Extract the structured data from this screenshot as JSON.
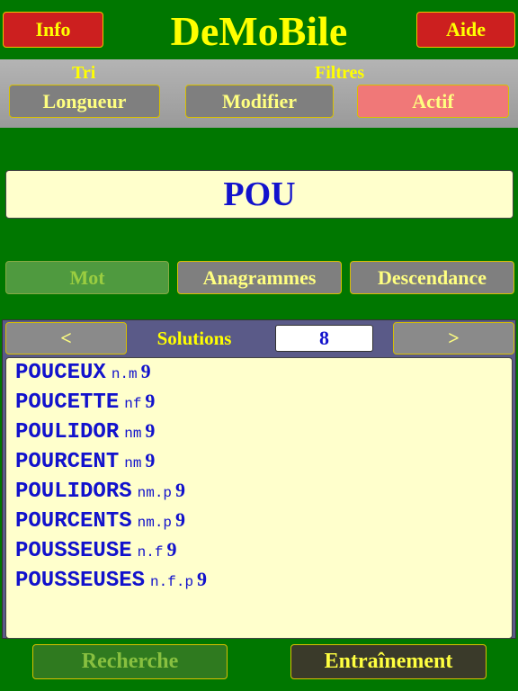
{
  "header": {
    "info_label": "Info",
    "title": "DeMoBile",
    "aide_label": "Aide"
  },
  "options": {
    "tri_label": "Tri",
    "filtres_label": "Filtres",
    "longueur_label": "Longueur",
    "modifier_label": "Modifier",
    "actif_label": "Actif"
  },
  "search": {
    "word": "POU"
  },
  "modes": {
    "mot_label": "Mot",
    "anagrammes_label": "Anagrammes",
    "descendance_label": "Descendance"
  },
  "solutions": {
    "prev_label": "<",
    "next_label": ">",
    "label": "Solutions",
    "count": "8",
    "items": [
      {
        "word": "POUCEUX",
        "cat": "n.m",
        "len": "9"
      },
      {
        "word": "POUCETTE",
        "cat": "nf",
        "len": "9"
      },
      {
        "word": "POULIDOR",
        "cat": "nm",
        "len": "9"
      },
      {
        "word": "POURCENT",
        "cat": "nm",
        "len": "9"
      },
      {
        "word": "POULIDORS",
        "cat": "nm.p",
        "len": "9"
      },
      {
        "word": "POURCENTS",
        "cat": "nm.p",
        "len": "9"
      },
      {
        "word": "POUSSEUSE",
        "cat": "n.f",
        "len": "9"
      },
      {
        "word": "POUSSEUSES",
        "cat": "n.f.p",
        "len": "9"
      }
    ]
  },
  "footer": {
    "recherche_label": "Recherche",
    "entrainement_label": "Entraînement"
  },
  "colors": {
    "background": "#007700",
    "accent_yellow": "#ffff00",
    "word_blue": "#1212cc",
    "info_red": "#cc1f1f",
    "actif_pink": "#f07878"
  }
}
